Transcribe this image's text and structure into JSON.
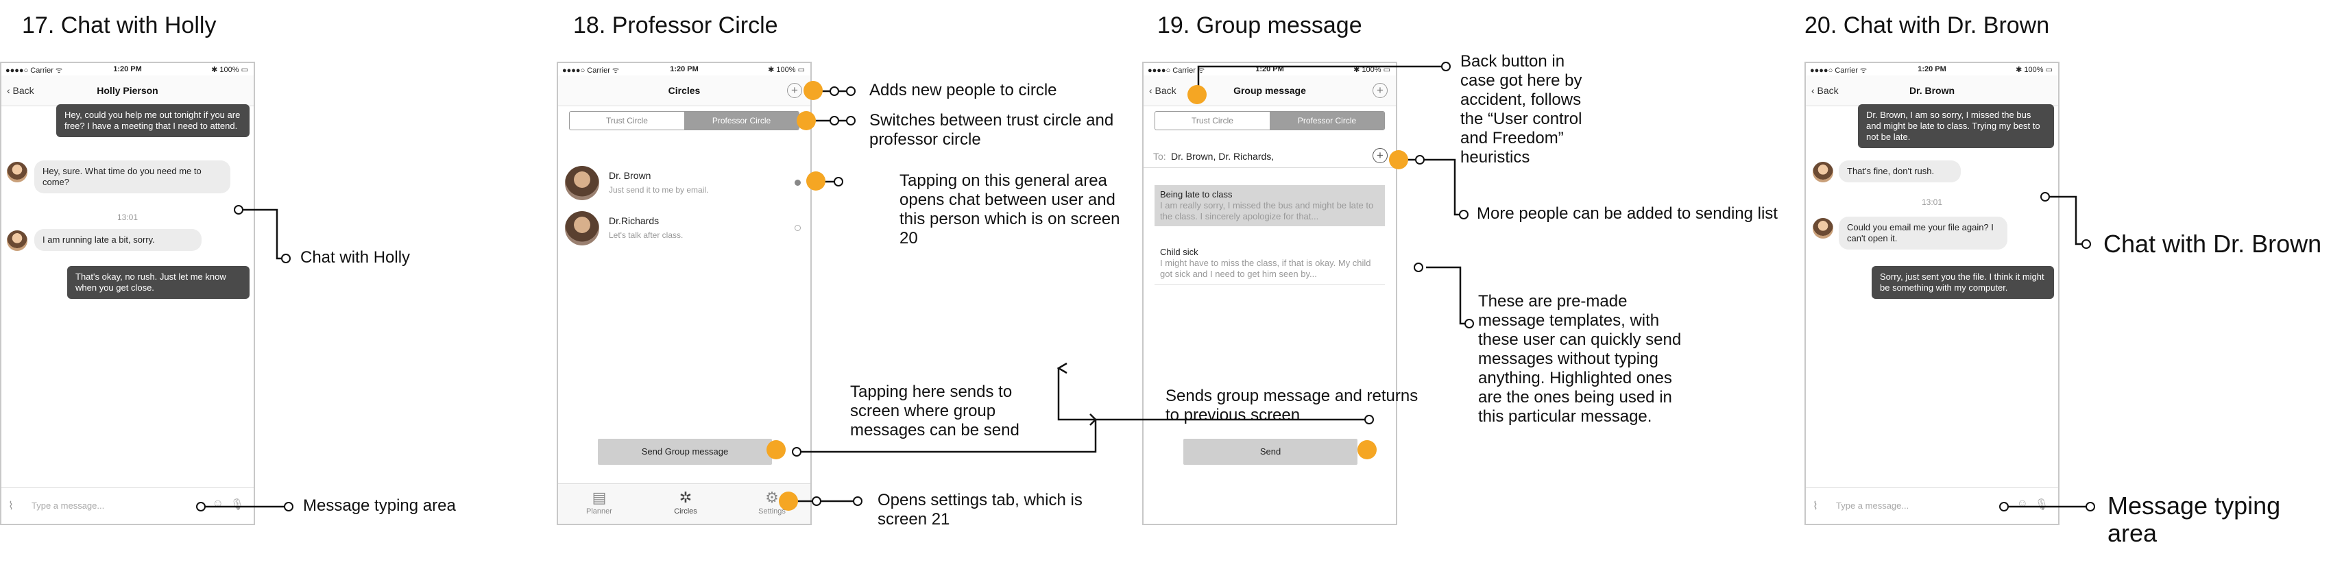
{
  "screens": {
    "s17": {
      "title": "17. Chat with Holly",
      "status": {
        "carrier": "●●●●○ Carrier ᯤ",
        "time": "1:20 PM",
        "battery": "✱ 100% ▭"
      },
      "nav": {
        "back": "‹ Back",
        "title": "Holly Pierson"
      },
      "messages": [
        {
          "text": "Hey, could you help me out tonight if you are free? I have a meeting that I need to attend."
        },
        {
          "text": "Hey, sure. What time do you need me to come?"
        },
        {
          "text": "I am running late a bit, sorry."
        },
        {
          "text": "That's okay, no rush. Just let me know when you get close."
        }
      ],
      "timestamp": "13:01",
      "input_placeholder": "Type a message..."
    },
    "s18": {
      "title": "18. Professor Circle",
      "status": {
        "carrier": "●●●●○ Carrier ᯤ",
        "time": "1:20 PM",
        "battery": "✱ 100% ▭"
      },
      "nav": {
        "title": "Circles",
        "plus": "+"
      },
      "segments": [
        "Trust Circle",
        "Professor Circle"
      ],
      "contacts": [
        {
          "name": "Dr. Brown",
          "sub": "Just send it to me by email."
        },
        {
          "name": "Dr.Richards",
          "sub": "Let's talk after class."
        }
      ],
      "send_button": "Send Group message",
      "tabs": [
        {
          "icon": "▤",
          "label": "Planner"
        },
        {
          "icon": "✲",
          "label": "Circles"
        },
        {
          "icon": "⚙",
          "label": "Settings"
        }
      ]
    },
    "s19": {
      "title": "19. Group message",
      "status": {
        "carrier": "●●●●○ Carrier ᯤ",
        "time": "1:20 PM",
        "battery": "✱ 100% ▭"
      },
      "nav": {
        "back": "‹ Back",
        "title": "Group message",
        "plus": "+"
      },
      "segments": [
        "Trust Circle",
        "Professor Circle"
      ],
      "to_label": "To:",
      "to_value": "Dr. Brown, Dr. Richards,",
      "templates": [
        {
          "title": "Being late to class",
          "body": "I am really sorry, I missed the bus and might be late to the class. I sincerely apologize for that..."
        },
        {
          "title": "Child sick",
          "body": "I might have to miss the class, if that is okay. My child got sick and I need to get him seen by..."
        }
      ],
      "send_button": "Send"
    },
    "s20": {
      "title": "20. Chat with Dr. Brown",
      "status": {
        "carrier": "●●●●○ Carrier ᯤ",
        "time": "1:20 PM",
        "battery": "✱ 100% ▭"
      },
      "nav": {
        "back": "‹ Back",
        "title": "Dr. Brown"
      },
      "messages": [
        {
          "text": "Dr. Brown, I am so sorry, I missed the bus and might be late to class. Trying my best to not be late."
        },
        {
          "text": "That's fine, don't rush."
        },
        {
          "text": "Could you email me your file again? I can't open it."
        },
        {
          "text": "Sorry, just sent you the file. I think it might be something with my computer."
        }
      ],
      "timestamp": "13:01",
      "input_placeholder": "Type a message..."
    }
  },
  "annotations": {
    "chat_with_holly": "Chat with Holly",
    "message_typing_area": "Message typing area",
    "adds_people": "Adds new people to circle",
    "switches_circle": "Switches between trust circle and professor circle",
    "tapping_general_area": "Tapping on this general area opens chat between user and this person which is on screen 20",
    "tapping_here_sends": "Tapping here sends to screen where group messages can be send",
    "opens_settings": "Opens settings tab, which is screen 21",
    "back_button": "Back button in case got here by accident, follows the “User control and Freedom” heuristics",
    "more_people": "More people can be added to sending list",
    "premade_templates": "These are pre-made message templates, with these user can quickly send messages without typing anything. Highlighted ones are the ones being used in this particular message.",
    "sends_group": "Sends group message and returns to previous screen",
    "chat_with_brown": "Chat with Dr. Brown",
    "message_typing_area_2": "Message typing area"
  },
  "colors": {
    "accent": "#f5a623",
    "dark_bubble": "#4a4a4a",
    "light_bubble": "#ececec",
    "selected_segment": "#9e9e9e",
    "highlight": "#d6d6d6"
  }
}
